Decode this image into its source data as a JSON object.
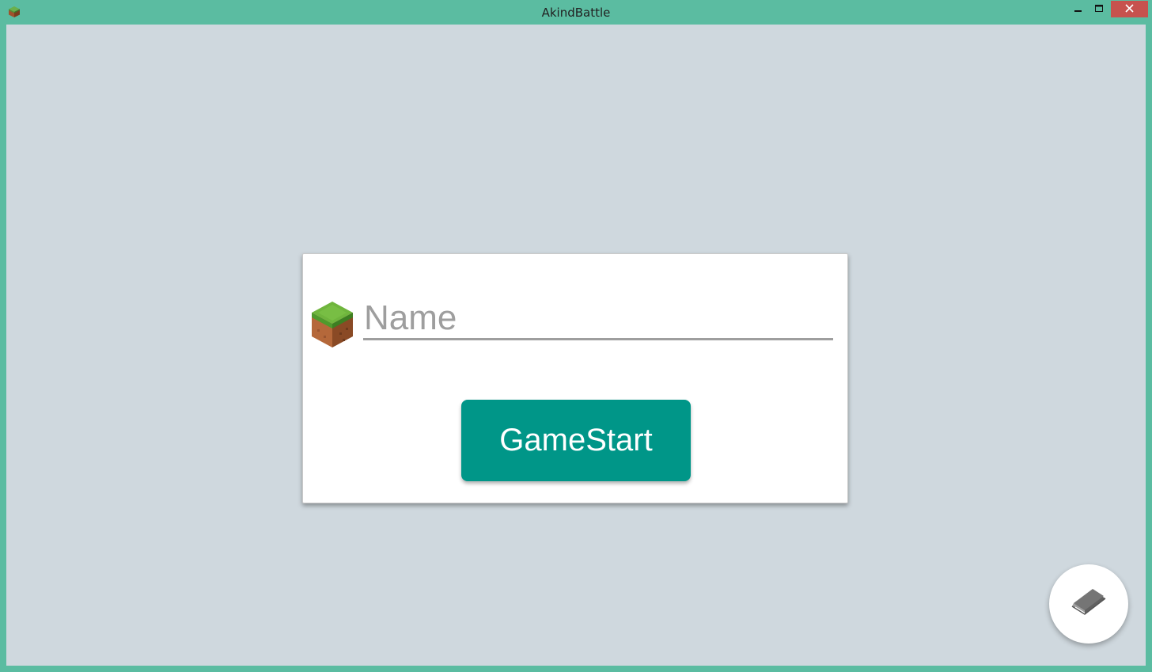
{
  "window": {
    "title": "AkindBattle",
    "frame_color": "#5bbca1",
    "close_color": "#c7524e"
  },
  "controls": {
    "minimize_icon": "minimize-icon",
    "maximize_icon": "maximize-icon",
    "close_icon": "close-icon"
  },
  "login": {
    "name_placeholder": "Name",
    "name_value": "",
    "block_icon": "grass-block-icon",
    "start_label": "GameStart",
    "accent_color": "#009688"
  },
  "fab": {
    "icon": "book-icon"
  }
}
